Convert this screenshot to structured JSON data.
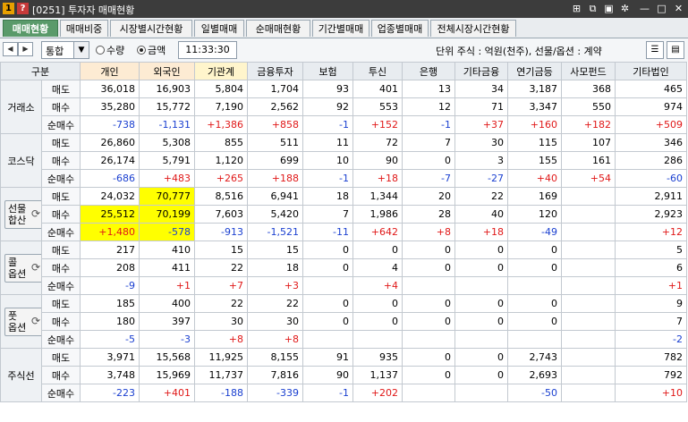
{
  "window": {
    "badge1": "1",
    "badge2": "?",
    "title": "[0251] 투자자 매매현황",
    "badge1_color": "#e8a000",
    "badge2_color": "#c73a3a"
  },
  "tabs": [
    {
      "label": "매매현황",
      "active": true
    },
    {
      "label": "매매비중"
    },
    {
      "label": "시장별시간현황"
    },
    {
      "label": "일별매매"
    },
    {
      "label": "순매매현황"
    },
    {
      "label": "기간별매매"
    },
    {
      "label": "업종별매매"
    },
    {
      "label": "전체시장시간현황"
    }
  ],
  "controls": {
    "market_select": "통합",
    "radio_qty": "수량",
    "radio_amount": "금액",
    "selected_radio": "금액",
    "time": "11:33:30",
    "unit_text": "단위 주식 : 억원(천주), 선물/옵션 : 계약"
  },
  "columns": [
    "구분",
    "개인",
    "외국인",
    "기관계",
    "금융투자",
    "보험",
    "투신",
    "은행",
    "기타금융",
    "연기금등",
    "사모펀드",
    "기타법인"
  ],
  "groups": [
    {
      "name": "거래소",
      "rows": [
        {
          "label": "매도",
          "values": [
            "36,018",
            "16,903",
            "5,804",
            "1,704",
            "93",
            "401",
            "13",
            "34",
            "3,187",
            "368",
            "465"
          ]
        },
        {
          "label": "매수",
          "values": [
            "35,280",
            "15,772",
            "7,190",
            "2,562",
            "92",
            "553",
            "12",
            "71",
            "3,347",
            "550",
            "974"
          ]
        },
        {
          "label": "순매수",
          "values": [
            "-738",
            "-1,131",
            "+1,386",
            "+858",
            "-1",
            "+152",
            "-1",
            "+37",
            "+160",
            "+182",
            "+509"
          ]
        }
      ]
    },
    {
      "name": "코스닥",
      "rows": [
        {
          "label": "매도",
          "values": [
            "26,860",
            "5,308",
            "855",
            "511",
            "11",
            "72",
            "7",
            "30",
            "115",
            "107",
            "346"
          ]
        },
        {
          "label": "매수",
          "values": [
            "26,174",
            "5,791",
            "1,120",
            "699",
            "10",
            "90",
            "0",
            "3",
            "155",
            "161",
            "286"
          ]
        },
        {
          "label": "순매수",
          "values": [
            "-686",
            "+483",
            "+265",
            "+188",
            "-1",
            "+18",
            "-7",
            "-27",
            "+40",
            "+54",
            "-60"
          ]
        }
      ]
    },
    {
      "name": "선물\n합산",
      "button": true,
      "rows": [
        {
          "label": "매도",
          "values": [
            "24,032",
            "70,777",
            "8,516",
            "6,941",
            "18",
            "1,344",
            "20",
            "22",
            "169",
            "",
            "2,911"
          ]
        },
        {
          "label": "매수",
          "values": [
            "25,512",
            "70,199",
            "7,603",
            "5,420",
            "7",
            "1,986",
            "28",
            "40",
            "120",
            "",
            "2,923"
          ]
        },
        {
          "label": "순매수",
          "values": [
            "+1,480",
            "-578",
            "-913",
            "-1,521",
            "-11",
            "+642",
            "+8",
            "+18",
            "-49",
            "",
            "+12"
          ]
        }
      ]
    },
    {
      "name": "콜\n옵션",
      "button": true,
      "rows": [
        {
          "label": "매도",
          "values": [
            "217",
            "410",
            "15",
            "15",
            "0",
            "0",
            "0",
            "0",
            "0",
            "",
            "5"
          ]
        },
        {
          "label": "매수",
          "values": [
            "208",
            "411",
            "22",
            "18",
            "0",
            "4",
            "0",
            "0",
            "0",
            "",
            "6"
          ]
        },
        {
          "label": "순매수",
          "values": [
            "-9",
            "+1",
            "+7",
            "+3",
            "",
            "+4",
            "",
            "",
            "",
            "",
            "+1"
          ]
        }
      ]
    },
    {
      "name": "풋\n옵션",
      "button": true,
      "rows": [
        {
          "label": "매도",
          "values": [
            "185",
            "400",
            "22",
            "22",
            "0",
            "0",
            "0",
            "0",
            "0",
            "",
            "9"
          ]
        },
        {
          "label": "매수",
          "values": [
            "180",
            "397",
            "30",
            "30",
            "0",
            "0",
            "0",
            "0",
            "0",
            "",
            "7"
          ]
        },
        {
          "label": "순매수",
          "values": [
            "-5",
            "-3",
            "+8",
            "+8",
            "",
            "",
            "",
            "",
            "",
            "",
            "-2"
          ]
        }
      ]
    },
    {
      "name": "주식선",
      "rows": [
        {
          "label": "매도",
          "values": [
            "3,971",
            "15,568",
            "11,925",
            "8,155",
            "91",
            "935",
            "0",
            "0",
            "2,743",
            "",
            "782"
          ]
        },
        {
          "label": "매수",
          "values": [
            "3,748",
            "15,969",
            "11,737",
            "7,816",
            "90",
            "1,137",
            "0",
            "0",
            "2,693",
            "",
            "792"
          ]
        },
        {
          "label": "순매수",
          "values": [
            "-223",
            "+401",
            "-188",
            "-339",
            "-1",
            "+202",
            "",
            "",
            "-50",
            "",
            "+10"
          ]
        }
      ]
    }
  ],
  "highlights": [
    {
      "group": 2,
      "row": 0,
      "col": 1
    },
    {
      "group": 2,
      "row": 1,
      "col": 0
    },
    {
      "group": 2,
      "row": 1,
      "col": 1
    },
    {
      "group": 2,
      "row": 2,
      "col": 0
    },
    {
      "group": 2,
      "row": 2,
      "col": 1
    }
  ],
  "colors": {
    "positive": "#e01818",
    "negative": "#1a3fd0",
    "highlight": "#ffff00",
    "active_tab": "#5a9a6a"
  }
}
